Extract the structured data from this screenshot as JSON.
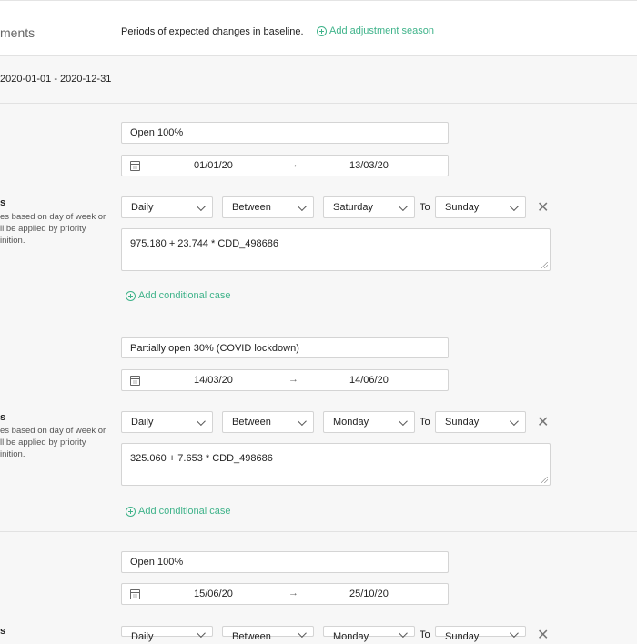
{
  "header": {
    "title": "ments",
    "description": "Periods of expected changes in baseline.",
    "add_season_label": "Add adjustment season"
  },
  "range": {
    "text": "2020-01-01 - 2020-12-31"
  },
  "conditions": {
    "title": "s",
    "desc_1": "es based on day of week or",
    "desc_2": "ll be applied by priority",
    "desc_3": "inition."
  },
  "seasons": [
    {
      "name": "Open 100%",
      "start": "01/01/20",
      "end": "13/03/20",
      "frequency": "Daily",
      "operator": "Between",
      "from_day": "Saturday",
      "to_label": "To",
      "to_day": "Sunday",
      "formula": "975.180 + 23.744 * CDD_498686",
      "add_case_label": "Add conditional case"
    },
    {
      "name": "Partially open 30% (COVID lockdown)",
      "start": "14/03/20",
      "end": "14/06/20",
      "frequency": "Daily",
      "operator": "Between",
      "from_day": "Monday",
      "to_label": "To",
      "to_day": "Sunday",
      "formula": "325.060 + 7.653 * CDD_498686",
      "add_case_label": "Add conditional case"
    },
    {
      "name": "Open 100%",
      "start": "15/06/20",
      "end": "25/10/20",
      "frequency": "Daily",
      "operator": "Between",
      "from_day": "Monday",
      "to_label": "To",
      "to_day": "Sunday"
    }
  ],
  "icons": {
    "calendar": "calendar-icon",
    "arrow": "arrow-right-icon",
    "chevron": "chevron-down-icon",
    "close": "close-icon",
    "add": "plus-circle-icon"
  },
  "colors": {
    "accent": "#3fb38a"
  }
}
